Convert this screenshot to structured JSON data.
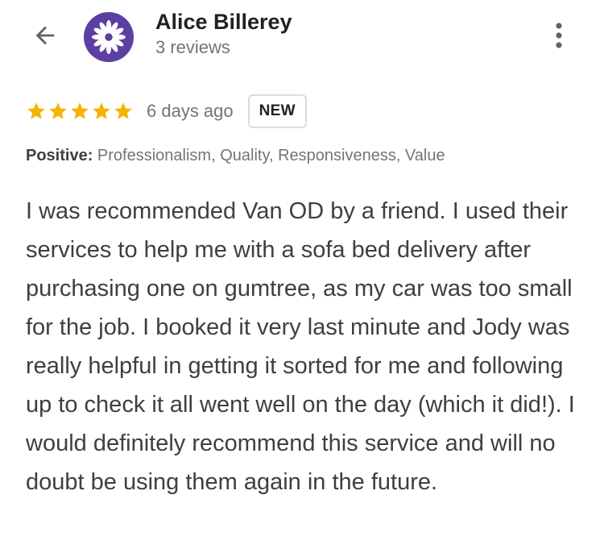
{
  "header": {
    "back_icon": "arrow-left-icon",
    "avatar_icon": "flower-icon",
    "avatar_color": "#5b3fa3",
    "author_name": "Alice Billerey",
    "review_count": "3 reviews",
    "more_icon": "more-vert-icon"
  },
  "review": {
    "rating": 5,
    "rating_max": 5,
    "star_color": "#f4b400",
    "time": "6 days ago",
    "badge": "NEW",
    "positive_label": "Positive:",
    "positive_values": "Professionalism, Quality, Responsiveness, Value",
    "text": "I was recommended Van OD by a friend. I used their services to help me with a sofa bed delivery after purchasing one on gumtree, as my car was too small for the job. I booked it very last minute and Jody was really helpful in getting it sorted for me and following up to check it all went well on the day (which it did!). I would definitely recommend this service and will no doubt be using them again in the future."
  }
}
